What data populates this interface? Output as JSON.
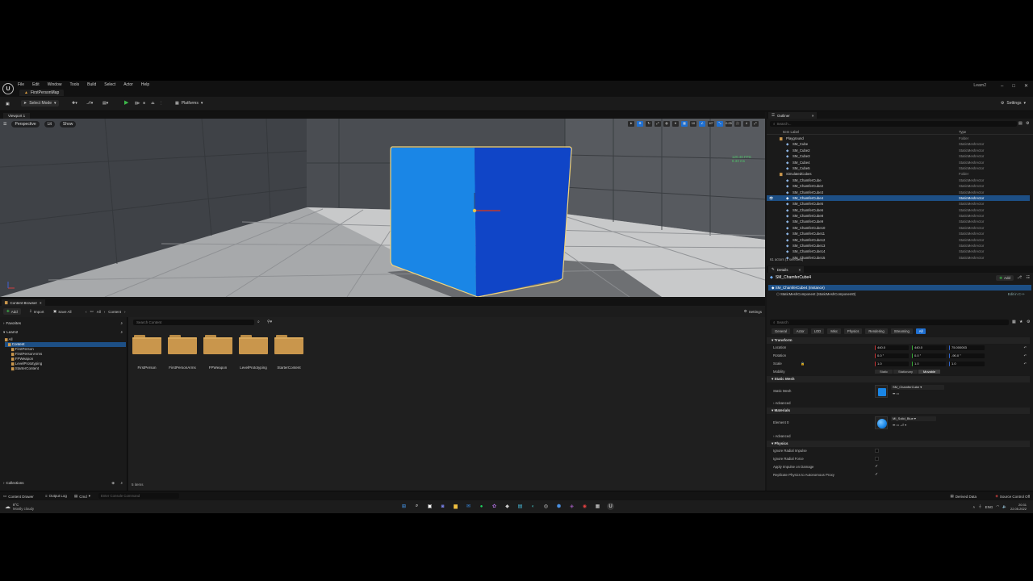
{
  "titlebar": {
    "menu": [
      "File",
      "Edit",
      "Window",
      "Tools",
      "Build",
      "Select",
      "Actor",
      "Help"
    ],
    "map_tab": "FirstPersonMap",
    "project": "Learn2"
  },
  "toolbar": {
    "select_mode": "Select Mode",
    "platforms": "Platforms",
    "settings": "Settings"
  },
  "viewport": {
    "tab": "Viewport 1",
    "perspective": "Perspective",
    "lit": "Lit",
    "show": "Show",
    "fps_line1": "120.40 FPS",
    "fps_line2": "8.33 ms",
    "grid_value": "10",
    "rot_value": "10°",
    "scale_value": "0.25",
    "cam_speed": "4",
    "colors": {
      "cube_light": "#1a86e6",
      "cube_dark": "#1045c7"
    }
  },
  "content_browser": {
    "tab": "Content Browser",
    "add": "Add",
    "import": "Import",
    "save_all": "Save All",
    "path_all": "All",
    "path_content": "Content",
    "settings": "Settings",
    "favorites": "Favorites",
    "project_root": "Learn2",
    "tree": [
      "All",
      "Content",
      "FirstPerson",
      "FirstPersonArms",
      "FPWeapon",
      "LevelPrototyping",
      "StarterContent"
    ],
    "search_placeholder": "Search Content",
    "folders": [
      "FirstPerson",
      "FirstPersonArms",
      "FPWeapon",
      "LevelPrototyping",
      "StarterContent"
    ],
    "item_count": "5 items",
    "collections": "Collections"
  },
  "outliner": {
    "tab": "Outliner",
    "search_placeholder": "Search...",
    "col_label": "Item Label",
    "col_type": "Type",
    "rows": [
      {
        "name": "Playground",
        "type": "Folder",
        "indent": 2
      },
      {
        "name": "SM_Cube",
        "type": "StaticMeshActor",
        "indent": 3
      },
      {
        "name": "SM_Cube2",
        "type": "StaticMeshActor",
        "indent": 3
      },
      {
        "name": "SM_Cube3",
        "type": "StaticMeshActor",
        "indent": 3
      },
      {
        "name": "SM_Cube4",
        "type": "StaticMeshActor",
        "indent": 3
      },
      {
        "name": "SM_Cube5",
        "type": "StaticMeshActor",
        "indent": 3
      },
      {
        "name": "SimulatedCubes",
        "type": "Folder",
        "indent": 2
      },
      {
        "name": "SM_ChamferCube",
        "type": "StaticMeshActor",
        "indent": 3
      },
      {
        "name": "SM_ChamferCube2",
        "type": "StaticMeshActor",
        "indent": 3
      },
      {
        "name": "SM_ChamferCube3",
        "type": "StaticMeshActor",
        "indent": 3
      },
      {
        "name": "SM_ChamferCube4",
        "type": "StaticMeshActor",
        "indent": 3,
        "selected": true
      },
      {
        "name": "SM_ChamferCube5",
        "type": "StaticMeshActor",
        "indent": 3
      },
      {
        "name": "SM_ChamferCube6",
        "type": "StaticMeshActor",
        "indent": 3
      },
      {
        "name": "SM_ChamferCube8",
        "type": "StaticMeshActor",
        "indent": 3
      },
      {
        "name": "SM_ChamferCube9",
        "type": "StaticMeshActor",
        "indent": 3
      },
      {
        "name": "SM_ChamferCube10",
        "type": "StaticMeshActor",
        "indent": 3
      },
      {
        "name": "SM_ChamferCube11",
        "type": "StaticMeshActor",
        "indent": 3
      },
      {
        "name": "SM_ChamferCube12",
        "type": "StaticMeshActor",
        "indent": 3
      },
      {
        "name": "SM_ChamferCube13",
        "type": "StaticMeshActor",
        "indent": 3
      },
      {
        "name": "SM_ChamferCube14",
        "type": "StaticMeshActor",
        "indent": 3
      },
      {
        "name": "SM_ChamferCube15",
        "type": "StaticMeshActor",
        "indent": 3
      }
    ],
    "footer": "61 actors (1 selected)"
  },
  "details": {
    "tab": "Details",
    "actor_name": "SM_ChamferCube4",
    "add": "Add",
    "instance_label": "SM_ChamferCube4 (Instance)",
    "component": "StaticMeshComponent (StaticMeshComponent0)",
    "edit_in_cpp": "Edit in C++",
    "search_placeholder": "Search",
    "filter_tabs": [
      "General",
      "Actor",
      "LOD",
      "Misc",
      "Physics",
      "Rendering",
      "Streaming",
      "All"
    ],
    "transform": "Transform",
    "location": "Location",
    "rotation": "Rotation",
    "scale": "Scale",
    "location_values": [
      "440.0",
      "440.0",
      "75.000003"
    ],
    "rotation_values": [
      "0.0 °",
      "0.0 °",
      "-90.0 °"
    ],
    "scale_values": [
      "1.0",
      "1.0",
      "1.0"
    ],
    "mobility": "Mobility",
    "mobility_options": [
      "Static",
      "Stationary",
      "Movable"
    ],
    "static_mesh_section": "Static Mesh",
    "static_mesh_label": "Static Mesh",
    "static_mesh_value": "SM_ChamferCube",
    "advanced": "Advanced",
    "materials_section": "Materials",
    "element0": "Element 0",
    "material_value": "MI_Solid_Blue",
    "physics_section": "Physics",
    "physics_rows": [
      "Ignore Radial Impulse",
      "Ignore Radial Force",
      "Apply Impulse on Damage",
      "Replicate Physics to Autonomous Proxy"
    ]
  },
  "status": {
    "content_drawer": "Content Drawer",
    "output_log": "Output Log",
    "cmd": "Cmd",
    "console_placeholder": "Enter Console Command",
    "derived_data": "Derived Data",
    "source_control": "Source Control Off"
  },
  "taskbar": {
    "weather_temp": "8°C",
    "weather_desc": "Mostly cloudy",
    "lang": "ENG",
    "time": "20:31",
    "date": "22.05.2022"
  }
}
